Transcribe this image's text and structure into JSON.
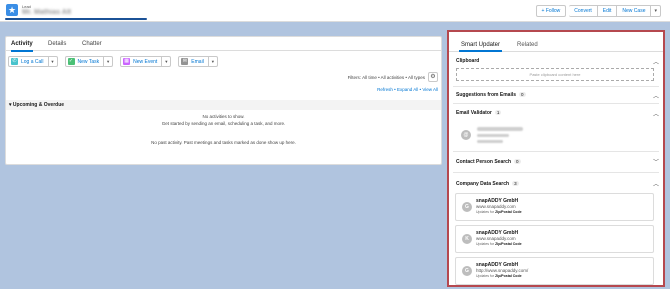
{
  "header": {
    "object_label": "Lead",
    "record_name": "Mr. Mathias Alt",
    "buttons": {
      "follow": "Follow",
      "convert": "Convert",
      "edit": "Edit",
      "new_case": "New Case",
      "caret": "▾"
    }
  },
  "activity": {
    "tabs": [
      "Activity",
      "Details",
      "Chatter"
    ],
    "actions": [
      {
        "label": "Log a Call",
        "icon": "phone-icon",
        "color": "#48c3cc"
      },
      {
        "label": "New Task",
        "icon": "task-icon",
        "color": "#4bc076"
      },
      {
        "label": "New Event",
        "icon": "calendar-icon",
        "color": "#cb65ff"
      },
      {
        "label": "Email",
        "icon": "email-icon",
        "color": "#939393"
      }
    ],
    "filters_text": "Filters: All time • All activities • All types",
    "links_text": "Refresh • Expand All • View All",
    "upcoming_label": "Upcoming & Overdue",
    "no_activities": "No activities to show.",
    "get_started": "Get started by sending an email, scheduling a task, and more.",
    "no_past": "No past activity. Past meetings and tasks marked as done show up here."
  },
  "smart": {
    "tabs": [
      "Smart Updater",
      "Related"
    ],
    "clipboard": {
      "title": "Clipboard",
      "placeholder": "Paste clipboard content here"
    },
    "suggestions": {
      "title": "Suggestions from Emails",
      "count": "0"
    },
    "validator": {
      "title": "Email Validator",
      "count": "1"
    },
    "contact_search": {
      "title": "Contact Person Search",
      "count": "0"
    },
    "company_search": {
      "title": "Company Data Search",
      "count": "3",
      "results": [
        {
          "initial": "G",
          "name": "snapADDY GmbH",
          "url": "www.snapaddy.com",
          "updates_prefix": "Updates for",
          "updates_field": "Zip/Postal Code"
        },
        {
          "initial": "K",
          "name": "snapADDY GmbH",
          "url": "www.snapaddy.com",
          "updates_prefix": "Updates for",
          "updates_field": "Zip/Postal Code"
        },
        {
          "initial": "G",
          "name": "snapADDY GmbH",
          "url": "http://www.snapaddy.com/",
          "updates_prefix": "Updates for",
          "updates_field": "Zip/Postal Code"
        }
      ]
    }
  }
}
